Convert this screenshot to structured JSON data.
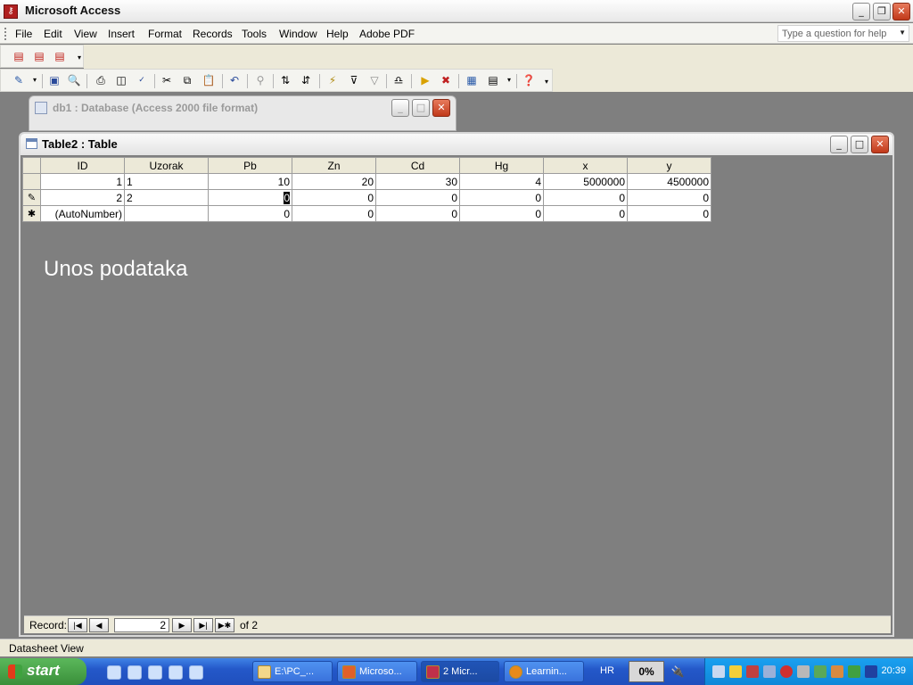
{
  "app": {
    "title": "Microsoft Access",
    "icon": "access-key-icon"
  },
  "menu": {
    "items": [
      "File",
      "Edit",
      "View",
      "Insert",
      "Format",
      "Records",
      "Tools",
      "Window",
      "Help",
      "Adobe PDF"
    ],
    "help_placeholder": "Type a question for help"
  },
  "toolbar": {
    "pdf_buttons": [
      "pdf-convert-icon",
      "pdf-email-icon",
      "pdf-review-icon"
    ],
    "buttons": [
      "design-view-icon",
      "save-icon",
      "file-search-icon",
      "print-icon",
      "print-preview-icon",
      "spelling-icon",
      "cut-icon",
      "copy-icon",
      "paste-icon",
      "undo-icon",
      "hyperlink-icon",
      "sort-ascending-icon",
      "sort-descending-icon",
      "filter-by-selection-icon",
      "filter-by-form-icon",
      "apply-filter-icon",
      "find-icon",
      "new-record-icon",
      "delete-record-icon",
      "database-window-icon",
      "new-object-icon",
      "help-icon"
    ]
  },
  "db_window": {
    "title": "db1 : Database (Access 2000 file format)"
  },
  "table_window": {
    "title": "Table2 : Table",
    "columns": [
      "ID",
      "Uzorak",
      "Pb",
      "Zn",
      "Cd",
      "Hg",
      "x",
      "y"
    ],
    "rows": [
      {
        "selector": "",
        "cells": [
          "1",
          "1",
          "10",
          "20",
          "30",
          "4",
          "5000000",
          "4500000"
        ]
      },
      {
        "selector": "✎",
        "cells": [
          "2",
          "2",
          "0",
          "0",
          "0",
          "0",
          "0",
          "0"
        ]
      },
      {
        "selector": "✱",
        "cells": [
          "(AutoNumber)",
          "",
          "0",
          "0",
          "0",
          "0",
          "0",
          "0"
        ]
      }
    ],
    "overlay_text": "Unos podataka"
  },
  "navigation": {
    "label": "Record:",
    "current": "2",
    "of_label": "of",
    "total": "2"
  },
  "status": {
    "text": "Datasheet View"
  },
  "taskbar": {
    "start": "start",
    "tasks": [
      "E:\\PC_...",
      "Microso...",
      "2 Micr...",
      "Learnin..."
    ],
    "language": "HR",
    "progress": "0%",
    "clock": "20:39"
  }
}
